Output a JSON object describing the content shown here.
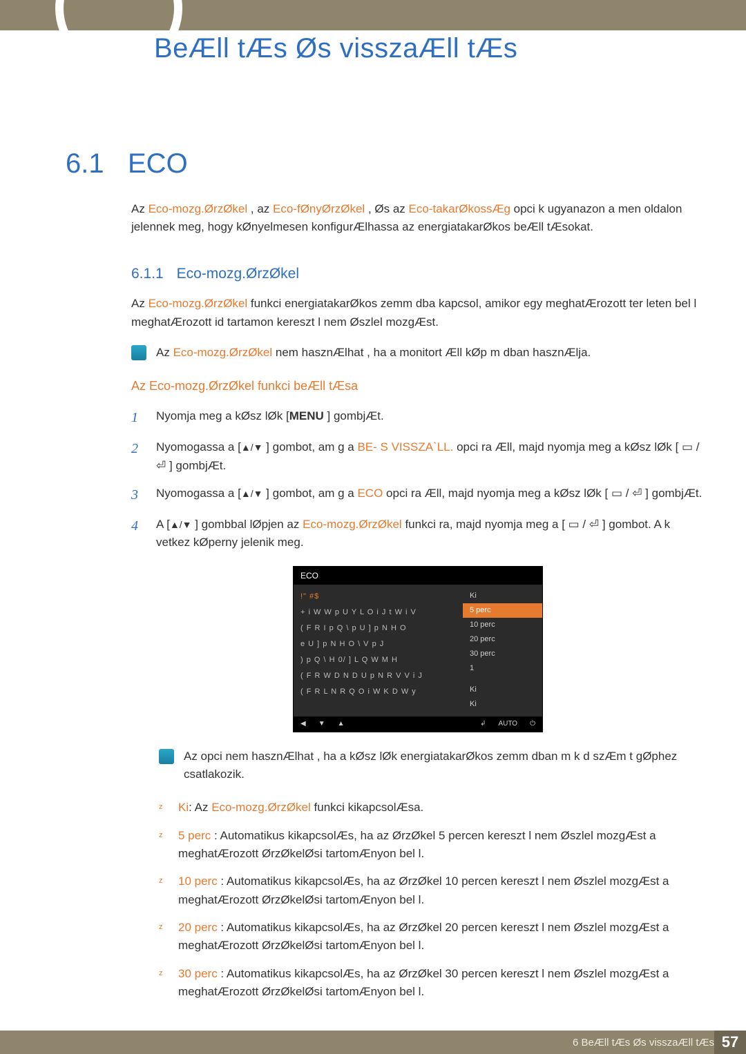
{
  "chapterTitle": "BeÆll tÆs Øs visszaÆll tÆs",
  "sectionNum": "6.1",
  "sectionName": "ECO",
  "intro": {
    "pre1": "Az ",
    "h1": "Eco-mozg.ØrzØkel",
    "mid1": " , az ",
    "h2": "Eco-fØnyØrzØkel",
    "mid2": " , Øs az ",
    "h3": "Eco-takarØkossÆg",
    "post": " opci k ugyanazon a men oldalon jelennek meg, hogy kØnyelmesen konfigurÆlhassa az energiatakarØkos beÆll tÆsokat."
  },
  "subNum": "6.1.1",
  "subName": "Eco-mozg.ØrzØkel",
  "subPara": {
    "pre": "Az ",
    "h": "Eco-mozg.ØrzØkel",
    "post": "  funkci  energiatakarØkos  zemm dba kapcsol, amikor egy meghatÆrozott ter leten bel l meghatÆrozott id tartamon kereszt l nem Øszlel mozgÆst."
  },
  "note1": {
    "pre": "Az ",
    "h": "Eco-mozg.ØrzØkel",
    "post": "  nem hasznÆlhat , ha a monitort Æll  kØp m dban hasznÆlja."
  },
  "procTitle": "Az Eco-mozg.ØrzØkel  funkci  beÆll tÆsa",
  "steps": [
    {
      "n": "1",
      "pre": "Nyomja meg a kØsz lØk [",
      "b": "MENU",
      "post": " ] gombjÆt."
    },
    {
      "n": "2",
      "pre": "Nyomogassa a [",
      "glyph": "▲/▼",
      "mid": " ] gombot, am g a ",
      "h": "BE- S VISSZA`LL.",
      "post": "  opci ra Æll, majd nyomja meg a kØsz lØk [ ▭ / ⏎ ] gombjÆt."
    },
    {
      "n": "3",
      "pre": "Nyomogassa a [",
      "glyph": "▲/▼",
      "mid": " ] gombot, am g a ",
      "h": "ECO",
      "post": " opci ra Æll, majd nyomja meg a kØsz lØk [ ▭ / ⏎ ] gombjÆt."
    },
    {
      "n": "4",
      "pre": "A [",
      "glyph": "▲/▼",
      "mid": " ] gombbal lØpjen az ",
      "h": "Eco-mozg.ØrzØkel",
      "post": "  funkci ra, majd nyomja meg a [ ▭ / ⏎ ] gombot. A k vetkez  kØperny  jelenik meg."
    }
  ],
  "menu": {
    "title": "ECO",
    "left": [
      "!\"  #$",
      "+ i W W p U Y L O i J t W i V",
      "( F R   I p Q \\ p U ] p N H O",
      "e U ] p N H O \\ V p J",
      ") p Q \\ H 0/ ] L Q W M H",
      "( F R   W D N D U p N R V V i J",
      "( F R   L N R Q   O i W K D W y"
    ],
    "rightHead": "Ki",
    "rightSel": "5 perc",
    "right": [
      "10 perc",
      "20 perc",
      "30 perc",
      "1"
    ],
    "rightTail": [
      "Ki",
      "Ki"
    ],
    "footRight": [
      "↲",
      "AUTO",
      "⏻"
    ]
  },
  "note2": "Az opci  nem hasznÆlhat , ha a kØsz lØk energiatakarØkos  zemm dban m k d  szÆm t gØphez csatlakozik.",
  "options": [
    {
      "h": "Ki",
      "sep": ": Az ",
      "h2": "Eco-mozg.ØrzØkel",
      "post": "  funkci  kikapcsolÆsa."
    },
    {
      "h": "5 perc",
      "post": " : Automatikus kikapcsolÆs, ha az ØrzØkel  5 percen kereszt l nem Øszlel mozgÆst a meghatÆrozott ØrzØkelØsi tartomÆnyon bel l."
    },
    {
      "h": "10 perc",
      "post": " : Automatikus kikapcsolÆs, ha az ØrzØkel  10 percen kereszt l nem Øszlel mozgÆst a meghatÆrozott ØrzØkelØsi tartomÆnyon bel l."
    },
    {
      "h": "20 perc",
      "post": " : Automatikus kikapcsolÆs, ha az ØrzØkel  20 percen kereszt l nem Øszlel mozgÆst a meghatÆrozott ØrzØkelØsi tartomÆnyon bel l."
    },
    {
      "h": "30 perc",
      "post": " : Automatikus kikapcsolÆs, ha az ØrzØkel  30 percen kereszt l nem Øszlel mozgÆst a meghatÆrozott ØrzØkelØsi tartomÆnyon bel l."
    }
  ],
  "footerText": "6 BeÆll tÆs Øs visszaÆll tÆs",
  "pageNum": "57"
}
